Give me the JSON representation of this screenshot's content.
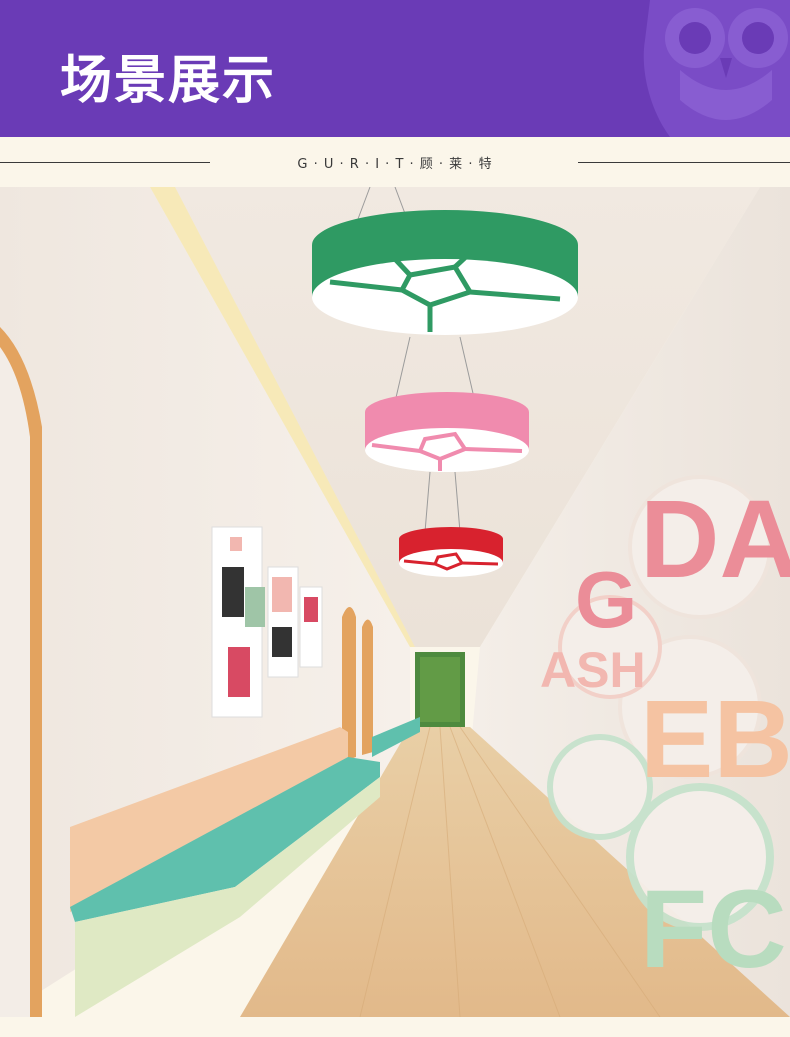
{
  "header": {
    "title": "场景展示",
    "background_color": "#6a3bb6",
    "logo_icon": "owl-icon"
  },
  "brand_line": {
    "text": "G · U · R · I · T · 顾 · 莱 · 特"
  },
  "scene": {
    "subject": "corridor-photo",
    "lamps": [
      {
        "icon": "football-pendant-lamp-icon",
        "color": "#2f9a63"
      },
      {
        "icon": "football-pendant-lamp-icon",
        "color": "#f08bae"
      },
      {
        "icon": "football-pendant-lamp-icon",
        "color": "#d8222e"
      }
    ],
    "accent_colors": {
      "bench": "#5fc0ad",
      "bench_back": "#f3c9a5",
      "floor": "#e7c493",
      "wall": "#f3ede7"
    }
  }
}
